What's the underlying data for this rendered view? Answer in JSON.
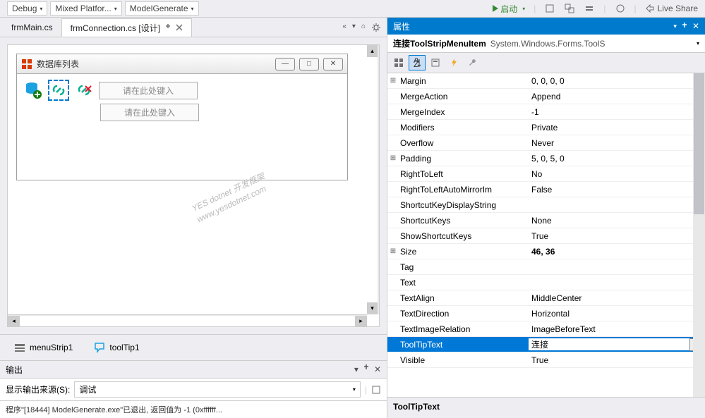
{
  "topbar": {
    "config1": "Debug",
    "config2": "Mixed Platfor...",
    "config3": "ModelGenerate",
    "run_label": "启动",
    "live_share": "Live Share"
  },
  "tabs": {
    "tab1": "frmMain.cs",
    "tab2": "frmConnection.cs [设计]"
  },
  "form": {
    "title": "数据库列表",
    "placeholder": "请在此处键入"
  },
  "tray": {
    "item1": "menuStrip1",
    "item2": "toolTip1"
  },
  "output": {
    "title": "输出",
    "source_label": "显示输出来源(S):",
    "source_value": "调试",
    "text": "程序\"[18444] ModelGenerate.exe\"已退出, 返回值为 -1 (0xffffff..."
  },
  "properties": {
    "header": "属性",
    "selector_name": "连接ToolStripMenuItem",
    "selector_type": "System.Windows.Forms.ToolS",
    "rows": [
      {
        "expand": "+",
        "name": "Margin",
        "value": "0, 0, 0, 0"
      },
      {
        "expand": "",
        "name": "MergeAction",
        "value": "Append"
      },
      {
        "expand": "",
        "name": "MergeIndex",
        "value": "-1"
      },
      {
        "expand": "",
        "name": "Modifiers",
        "value": "Private"
      },
      {
        "expand": "",
        "name": "Overflow",
        "value": "Never"
      },
      {
        "expand": "+",
        "name": "Padding",
        "value": "5, 0, 5, 0"
      },
      {
        "expand": "",
        "name": "RightToLeft",
        "value": "No"
      },
      {
        "expand": "",
        "name": "RightToLeftAutoMirrorIm",
        "value": "False"
      },
      {
        "expand": "",
        "name": "ShortcutKeyDisplayString",
        "value": ""
      },
      {
        "expand": "",
        "name": "ShortcutKeys",
        "value": "None"
      },
      {
        "expand": "",
        "name": "ShowShortcutKeys",
        "value": "True"
      },
      {
        "expand": "+",
        "name": "Size",
        "value": "46, 36",
        "bold": true
      },
      {
        "expand": "",
        "name": "Tag",
        "value": ""
      },
      {
        "expand": "",
        "name": "Text",
        "value": ""
      },
      {
        "expand": "",
        "name": "TextAlign",
        "value": "MiddleCenter"
      },
      {
        "expand": "",
        "name": "TextDirection",
        "value": "Horizontal"
      },
      {
        "expand": "",
        "name": "TextImageRelation",
        "value": "ImageBeforeText"
      },
      {
        "expand": "",
        "name": "ToolTipText",
        "value": "连接",
        "selected": true
      },
      {
        "expand": "",
        "name": "Visible",
        "value": "True"
      }
    ],
    "desc_title": "ToolTipText"
  },
  "watermark": {
    "line1": "YES dotnet 开发框架",
    "line2": "www.yesdotnet.com"
  }
}
